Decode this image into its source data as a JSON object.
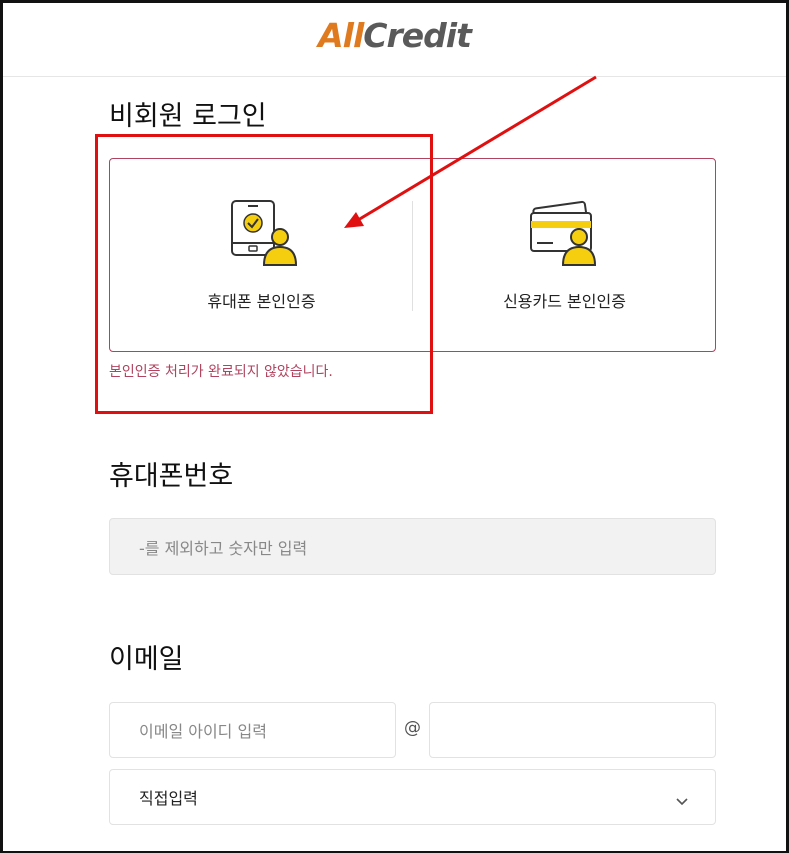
{
  "logo": {
    "part1": "All",
    "part2": "Credit"
  },
  "login": {
    "title": "비회원 로그인",
    "options": [
      {
        "label": "휴대폰 본인인증",
        "icon": "phone-verify-icon"
      },
      {
        "label": "신용카드 본인인증",
        "icon": "card-verify-icon"
      }
    ],
    "error": "본인인증 처리가 완료되지 않았습니다."
  },
  "phone": {
    "title": "휴대폰번호",
    "placeholder": "-를 제외하고 숫자만 입력"
  },
  "email": {
    "title": "이메일",
    "id_placeholder": "이메일 아이디 입력",
    "at": "@",
    "domain_value": "",
    "select_value": "직접입력"
  },
  "colors": {
    "brand_orange": "#e07a1f",
    "accent": "#b0435f",
    "icon_yellow": "#f5cf0f",
    "annotation_red": "#e01010"
  }
}
